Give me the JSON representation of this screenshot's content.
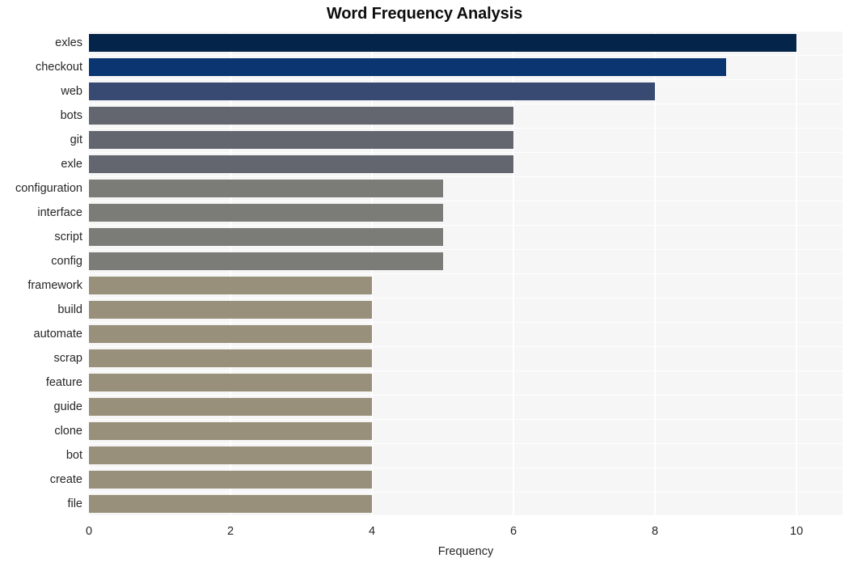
{
  "chart_data": {
    "type": "bar",
    "orientation": "horizontal",
    "title": "Word Frequency Analysis",
    "xlabel": "Frequency",
    "ylabel": "",
    "xlim": [
      0,
      10.65
    ],
    "xticks": [
      0,
      2,
      4,
      6,
      8,
      10
    ],
    "xtick_labels": [
      "0",
      "2",
      "4",
      "6",
      "8",
      "10"
    ],
    "grid": true,
    "grid_axis": "both",
    "legend": null,
    "background": "#f6f6f6",
    "categories": [
      "exles",
      "checkout",
      "web",
      "bots",
      "git",
      "exle",
      "configuration",
      "interface",
      "script",
      "config",
      "framework",
      "build",
      "automate",
      "scrap",
      "feature",
      "guide",
      "clone",
      "bot",
      "create",
      "file"
    ],
    "values": [
      10,
      9,
      8,
      6,
      6,
      6,
      5,
      5,
      5,
      5,
      4,
      4,
      4,
      4,
      4,
      4,
      4,
      4,
      4,
      4
    ],
    "bar_colors": [
      "#052449",
      "#0b3570",
      "#394a72",
      "#63666e",
      "#63666e",
      "#63666e",
      "#7b7b78",
      "#7b7b78",
      "#7b7b78",
      "#7b7b78",
      "#98907a",
      "#98907a",
      "#98907a",
      "#98907a",
      "#98907a",
      "#98907a",
      "#98907a",
      "#98907a",
      "#98907a",
      "#98907a"
    ]
  }
}
